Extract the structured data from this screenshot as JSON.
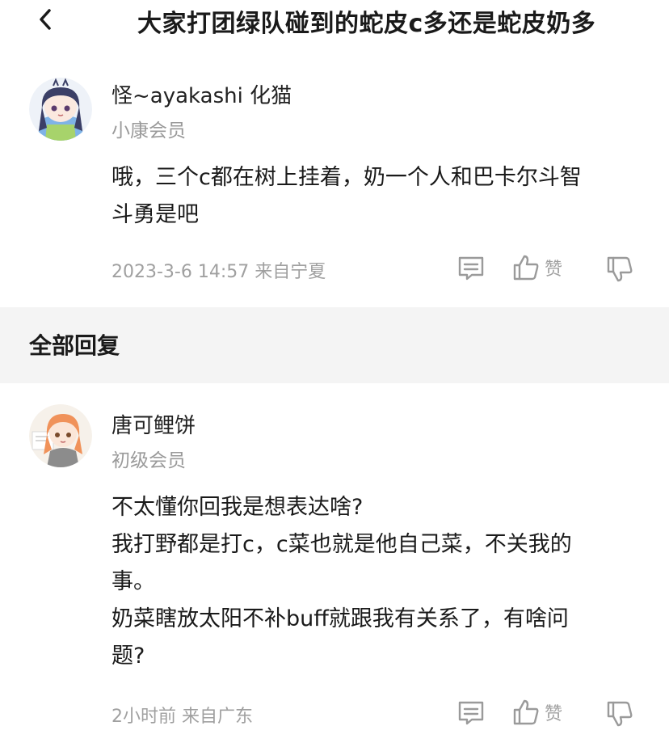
{
  "header": {
    "title": "大家打团绿队碰到的蛇皮c多还是蛇皮奶多"
  },
  "original_post": {
    "username": "怪~ayakashi 化猫",
    "rank": "小康会员",
    "content_lines": [
      "哦，三个c都在树上挂着，奶一个人和巴卡尔斗智",
      "斗勇是吧"
    ],
    "meta": "2023-3-6 14:57  来自宁夏",
    "like_label": "赞",
    "avatar_icon": "anime-avatar-blue-hair"
  },
  "section": {
    "title": "全部回复"
  },
  "reply": {
    "username": "唐可鲤饼",
    "rank": "初级会员",
    "content_lines": [
      "不太懂你回我是想表达啥?",
      "我打野都是打c，c菜也就是他自己菜，不关我的",
      "事。",
      "奶菜瞎放太阳不补buff就跟我有关系了，有啥问",
      "题?"
    ],
    "meta": "2小时前  来自广东",
    "like_label": "赞",
    "avatar_icon": "anime-avatar-orange-hair"
  },
  "icons": {
    "back": "chevron-left-icon",
    "comment": "comment-icon",
    "like": "thumbs-up-icon",
    "dislike": "thumbs-down-icon"
  },
  "colors": {
    "section_band": "#f4f4f4",
    "secondary_text": "#9a9a9a",
    "icon_gray": "#9a9a9a"
  }
}
